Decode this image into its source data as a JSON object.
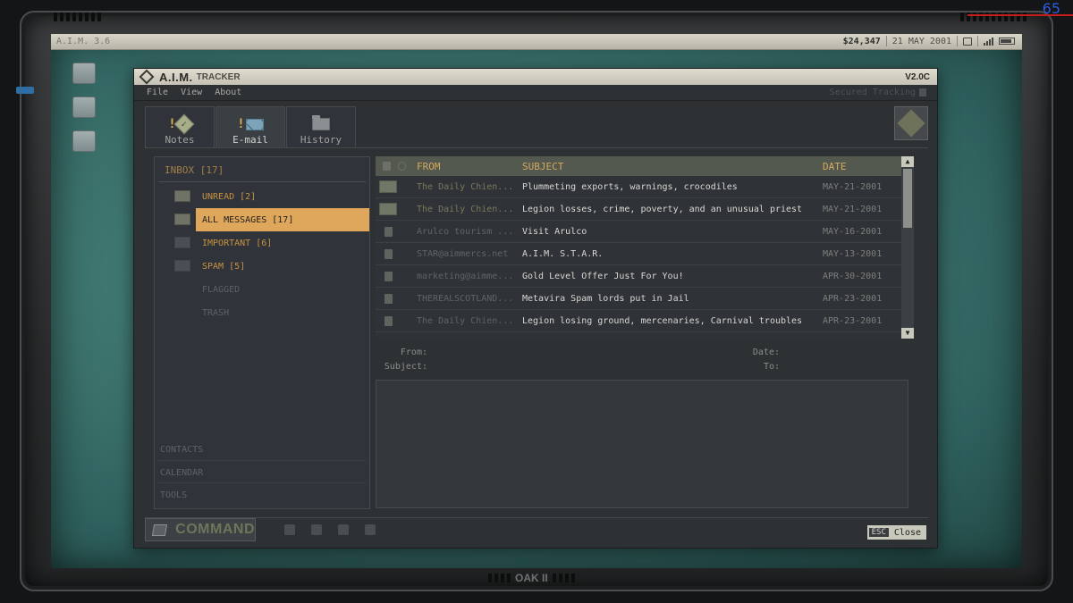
{
  "hud": {
    "fps": "65"
  },
  "taskbar": {
    "left_label": "A.I.M. 3.6",
    "money": "$24,347",
    "date": "21 MAY 2001"
  },
  "window": {
    "title": "A.I.M.",
    "subtitle": "TRACKER",
    "version": "V2.0C",
    "menu": [
      "File",
      "View",
      "About"
    ],
    "secured": "Secured Tracking"
  },
  "tabs": [
    {
      "label": "Notes",
      "icon": "notes-icon"
    },
    {
      "label": "E-mail",
      "icon": "envelope-icon"
    },
    {
      "label": "History",
      "icon": "folder-icon"
    }
  ],
  "folders": {
    "inbox_header": "INBOX [17]",
    "items": [
      {
        "label": "UNREAD [2]",
        "state": "normal"
      },
      {
        "label": "ALL MESSAGES [17]",
        "state": "selected"
      },
      {
        "label": "IMPORTANT [6]",
        "state": "normal"
      },
      {
        "label": "SPAM [5]",
        "state": "normal"
      },
      {
        "label": "FLAGGED",
        "state": "disabled"
      },
      {
        "label": "TRASH",
        "state": "disabled"
      }
    ],
    "bottom": [
      "CONTACTS",
      "CALENDAR",
      "TOOLS"
    ]
  },
  "email_list": {
    "columns": [
      "FROM",
      "SUBJECT",
      "DATE"
    ],
    "rows": [
      {
        "from": "The Daily Chien...",
        "subject": "Plummeting exports, warnings, crocodiles",
        "date": "MAY-21-2001",
        "unread": true
      },
      {
        "from": "The Daily Chien...",
        "subject": "Legion losses, crime, poverty, and an unusual priest",
        "date": "MAY-21-2001",
        "unread": true
      },
      {
        "from": "Arulco tourism ...",
        "subject": "Visit Arulco",
        "date": "MAY-16-2001",
        "unread": false
      },
      {
        "from": "STAR@aimmercs.net",
        "subject": "A.I.M. S.T.A.R.",
        "date": "MAY-13-2001",
        "unread": false
      },
      {
        "from": "marketing@aimme...",
        "subject": "Gold Level Offer Just For You!",
        "date": "APR-30-2001",
        "unread": false
      },
      {
        "from": "THEREALSCOTLAND...",
        "subject": "Metavira Spam lords put in Jail",
        "date": "APR-23-2001",
        "unread": false
      },
      {
        "from": "The Daily Chien...",
        "subject": "Legion losing ground, mercenaries, Carnival troubles",
        "date": "APR-23-2001",
        "unread": false
      }
    ]
  },
  "meta": {
    "from": "From:",
    "date": "Date:",
    "subject": "Subject:",
    "to": "To:"
  },
  "command": {
    "label": "COMMAND"
  },
  "esc": {
    "key": "ESC",
    "label": "Close"
  },
  "brand": "OAK II"
}
